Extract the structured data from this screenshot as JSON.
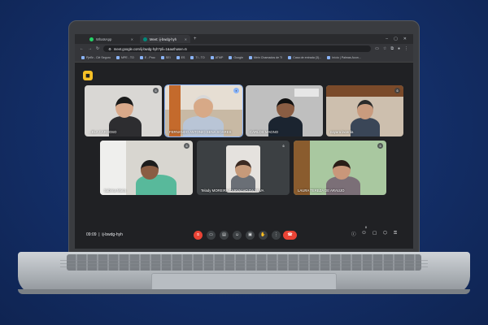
{
  "browser": {
    "tabs": [
      {
        "label": "WhatsApp",
        "active": false,
        "icon": "whatsapp-icon",
        "color": "#25d366"
      },
      {
        "label": "Meet: ij-bwdg-hyh",
        "active": true,
        "icon": "meet-icon",
        "color": "#00897b"
      }
    ],
    "url": "meet.google.com/ij-bwdg-hyh?pli=1&authuser=5",
    "bookmarks": [
      "PjeBr - Clé Seguro",
      "MPE - TO",
      "E - Proc",
      "SEI",
      "ES",
      "TI - TO",
      "ATMP",
      "Google",
      "Mein Chamados de TI",
      "Casa de entrada (3)...",
      "Início | Palmas Acon..."
    ]
  },
  "meet": {
    "meeting_code": "ij-bwdg-hyh",
    "time": "09:09",
    "participants": [
      {
        "name": "...ELA CARDOSO",
        "muted": true,
        "speaking": false
      },
      {
        "name": "FERNANDO ANTONIO SENA SOARES",
        "muted": false,
        "speaking": true
      },
      {
        "name": "CARLOS MAGNO",
        "muted": false,
        "speaking": false
      },
      {
        "name": "nayara lacerda",
        "muted": true,
        "speaking": false
      },
      {
        "name": "Sabrina Maria",
        "muted": true,
        "speaking": false
      },
      {
        "name": "Telady MOREIRA CARVALHO DA SILVA",
        "muted": true,
        "speaking": false
      },
      {
        "name": "LAURA TEREZA DE ARAUJO",
        "muted": true,
        "speaking": false
      }
    ],
    "people_count": "8"
  },
  "colors": {
    "accent": "#8ab4f8",
    "end_call": "#ea4335",
    "meet_logo": "#f6c026"
  }
}
